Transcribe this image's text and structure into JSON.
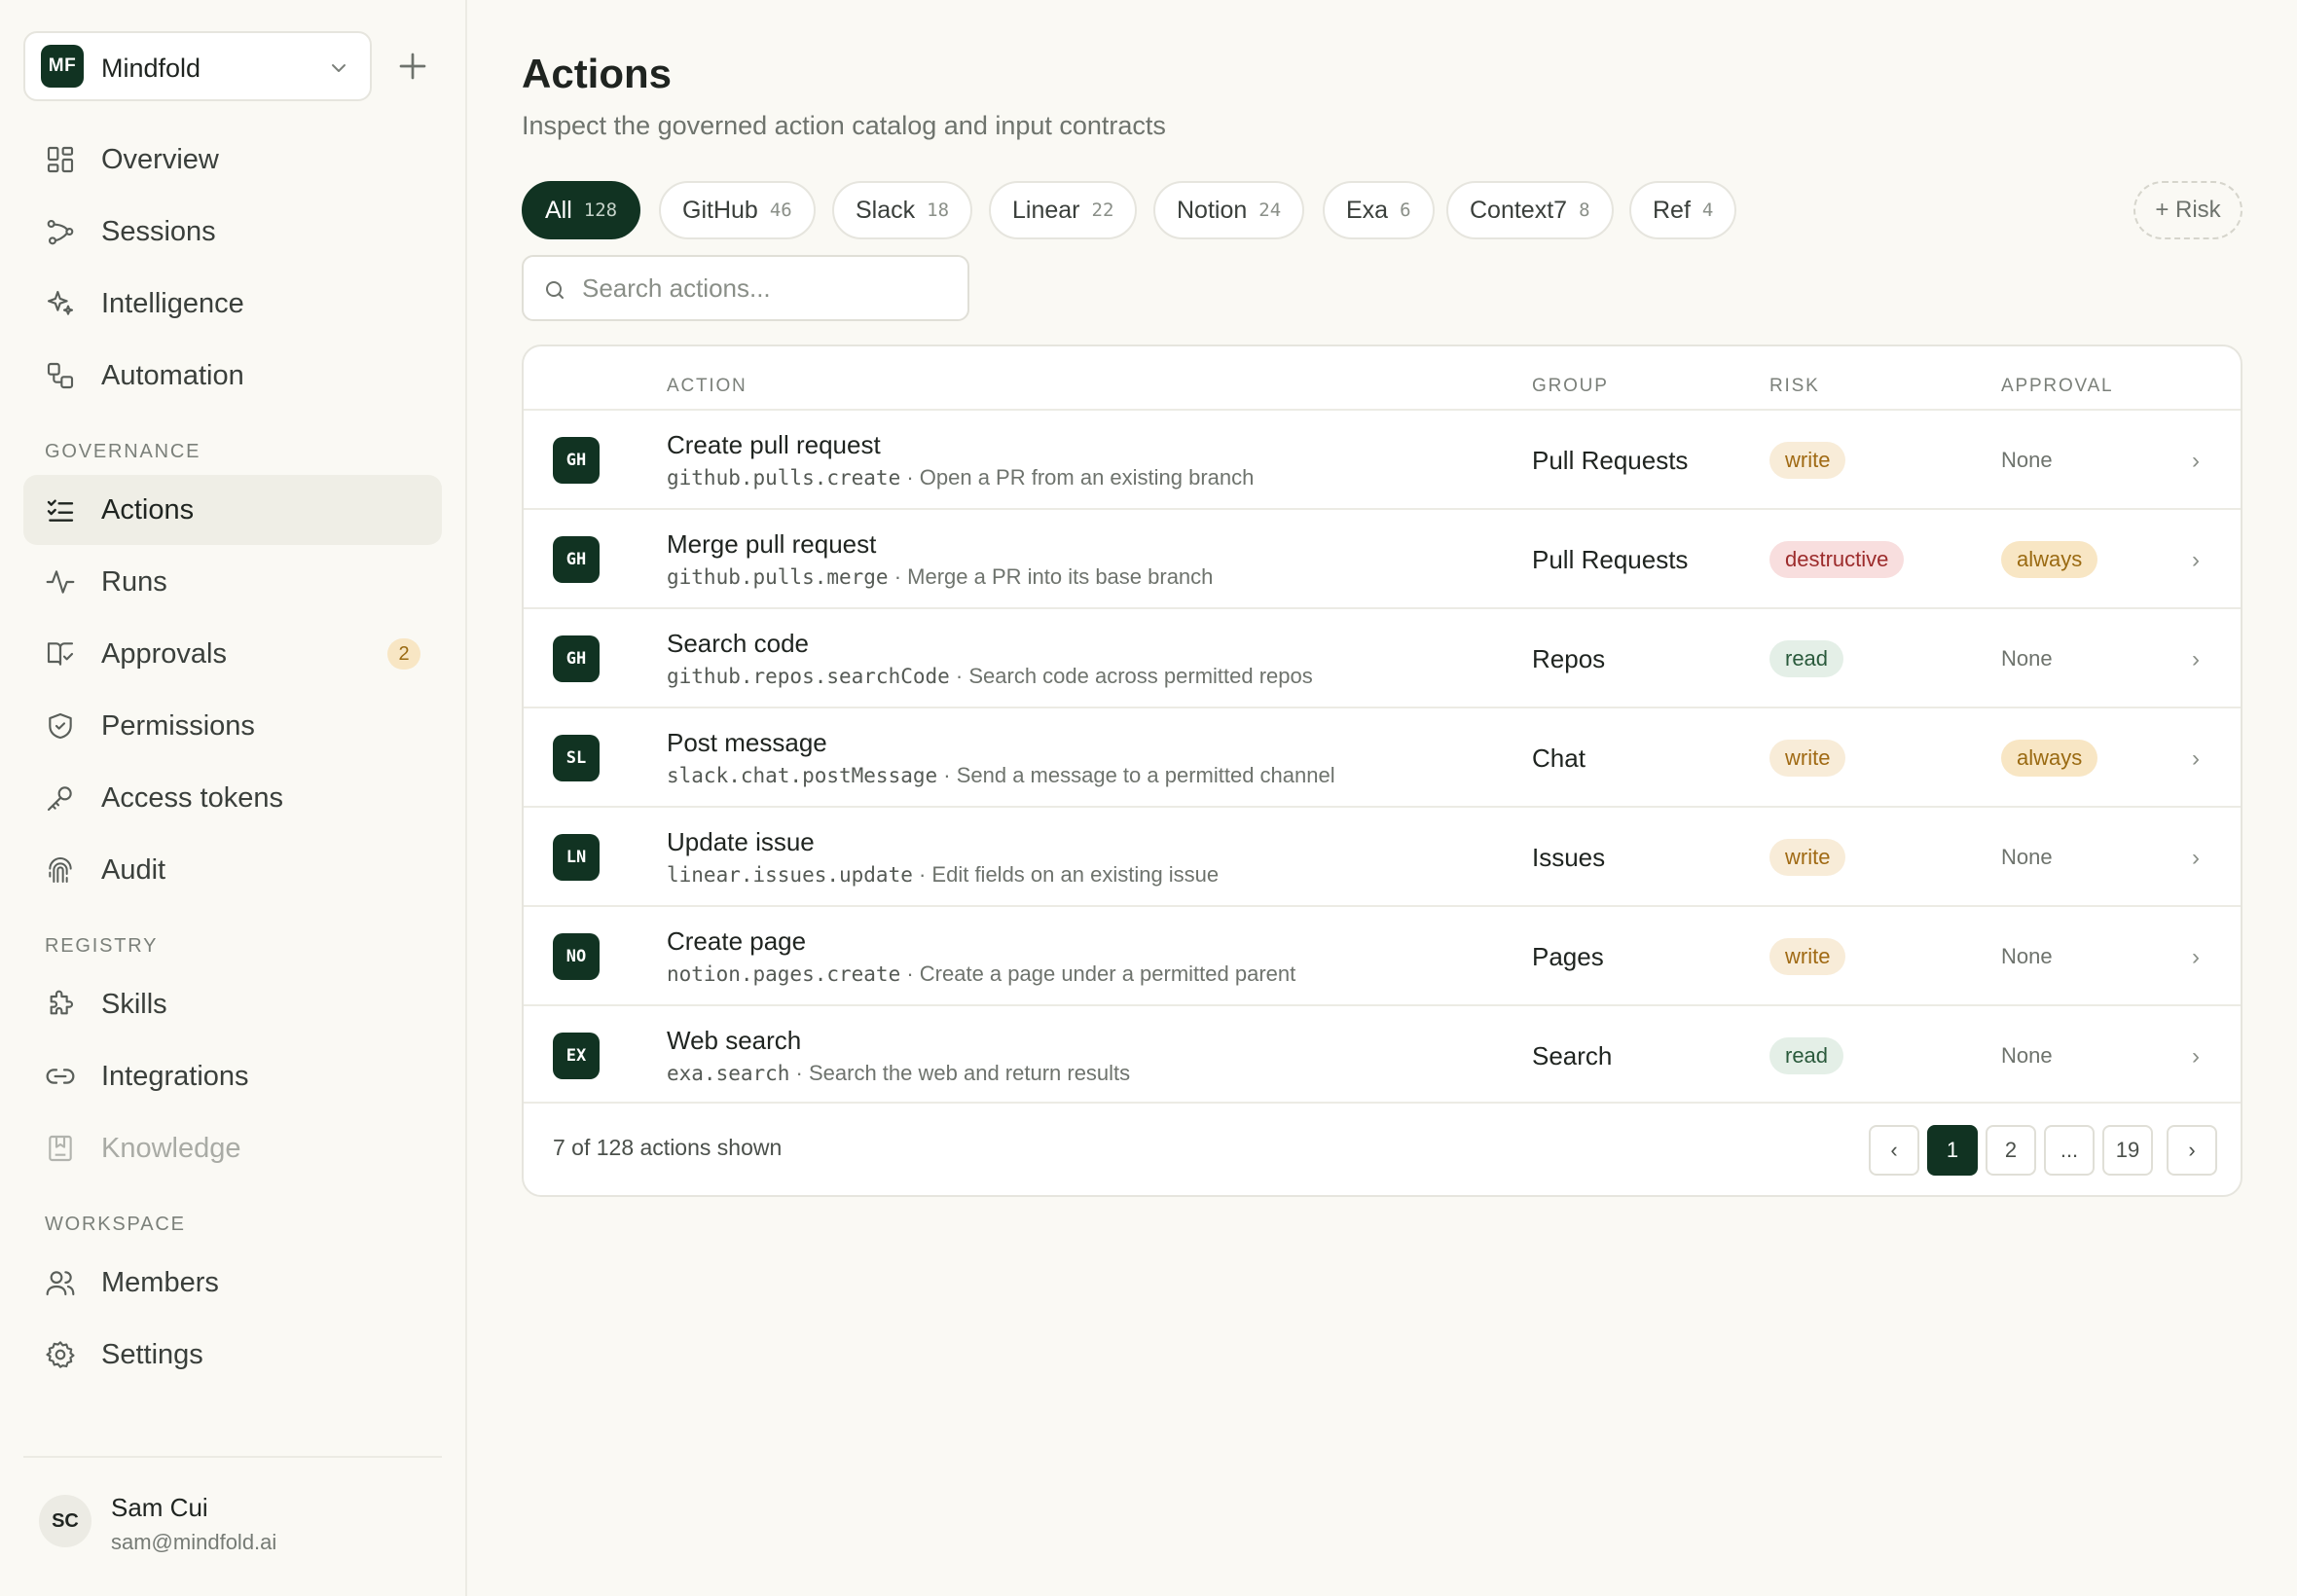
{
  "workspace": {
    "initials": "MF",
    "name": "Mindfold"
  },
  "nav": {
    "main": [
      {
        "label": "Overview",
        "icon": "overview-icon"
      },
      {
        "label": "Sessions",
        "icon": "sessions-icon"
      },
      {
        "label": "Intelligence",
        "icon": "sparkle-icon"
      },
      {
        "label": "Automation",
        "icon": "automation-icon"
      }
    ],
    "governance_title": "GOVERNANCE",
    "governance": [
      {
        "label": "Actions",
        "icon": "checklist-icon",
        "active": true
      },
      {
        "label": "Runs",
        "icon": "activity-icon"
      },
      {
        "label": "Approvals",
        "icon": "book-check-icon",
        "badge": "2"
      },
      {
        "label": "Permissions",
        "icon": "shield-icon"
      },
      {
        "label": "Access tokens",
        "icon": "key-icon"
      },
      {
        "label": "Audit",
        "icon": "fingerprint-icon"
      }
    ],
    "registry_title": "REGISTRY",
    "registry": [
      {
        "label": "Skills",
        "icon": "puzzle-icon"
      },
      {
        "label": "Integrations",
        "icon": "link-icon"
      },
      {
        "label": "Knowledge",
        "icon": "bookmark-icon",
        "muted": true
      }
    ],
    "workspace_title": "WORKSPACE",
    "workspace": [
      {
        "label": "Members",
        "icon": "users-icon"
      },
      {
        "label": "Settings",
        "icon": "gear-icon"
      }
    ]
  },
  "user": {
    "initials": "SC",
    "name": "Sam Cui",
    "email": "sam@mindfold.ai"
  },
  "page": {
    "title": "Actions",
    "subtitle": "Inspect the governed action catalog and input contracts"
  },
  "filters": [
    {
      "label": "All",
      "count": "128",
      "active": true
    },
    {
      "label": "GitHub",
      "count": "46"
    },
    {
      "label": "Slack",
      "count": "18"
    },
    {
      "label": "Linear",
      "count": "22"
    },
    {
      "label": "Notion",
      "count": "24"
    },
    {
      "label": "Exa",
      "count": "6"
    },
    {
      "label": "Context7",
      "count": "8"
    },
    {
      "label": "Ref",
      "count": "4"
    }
  ],
  "risk_filter": "+ Risk",
  "search": {
    "placeholder": "Search actions..."
  },
  "table": {
    "headers": {
      "action": "ACTION",
      "group": "GROUP",
      "risk": "RISK",
      "approval": "APPROVAL"
    },
    "rows": [
      {
        "provider": "GH",
        "name": "Create pull request",
        "code": "github.pulls.create",
        "desc": " · Open a PR from an existing branch",
        "group": "Pull Requests",
        "risk": "write",
        "approval": "None"
      },
      {
        "provider": "GH",
        "name": "Merge pull request",
        "code": "github.pulls.merge",
        "desc": " · Merge a PR into its base branch",
        "group": "Pull Requests",
        "risk": "destructive",
        "approval": "always"
      },
      {
        "provider": "GH",
        "name": "Search code",
        "code": "github.repos.searchCode",
        "desc": " · Search code across permitted repos",
        "group": "Repos",
        "risk": "read",
        "approval": "None"
      },
      {
        "provider": "SL",
        "name": "Post message",
        "code": "slack.chat.postMessage",
        "desc": " · Send a message to a permitted channel",
        "group": "Chat",
        "risk": "write",
        "approval": "always"
      },
      {
        "provider": "LN",
        "name": "Update issue",
        "code": "linear.issues.update",
        "desc": " · Edit fields on an existing issue",
        "group": "Issues",
        "risk": "write",
        "approval": "None"
      },
      {
        "provider": "NO",
        "name": "Create page",
        "code": "notion.pages.create",
        "desc": " · Create a page under a permitted parent",
        "group": "Pages",
        "risk": "write",
        "approval": "None"
      },
      {
        "provider": "EX",
        "name": "Web search",
        "code": "exa.search",
        "desc": " · Search the web and return results",
        "group": "Search",
        "risk": "read",
        "approval": "None"
      }
    ],
    "footer": "7 of 128 actions shown",
    "pagination": {
      "prev": "‹",
      "pages": [
        "1",
        "2",
        "...",
        "19"
      ],
      "current": "1",
      "next": "›"
    }
  },
  "colors": {
    "brand": "#113322",
    "background": "#faf9f4",
    "write": "#a06a14",
    "read": "#2a5a3c",
    "destructive": "#9c2b2b"
  }
}
